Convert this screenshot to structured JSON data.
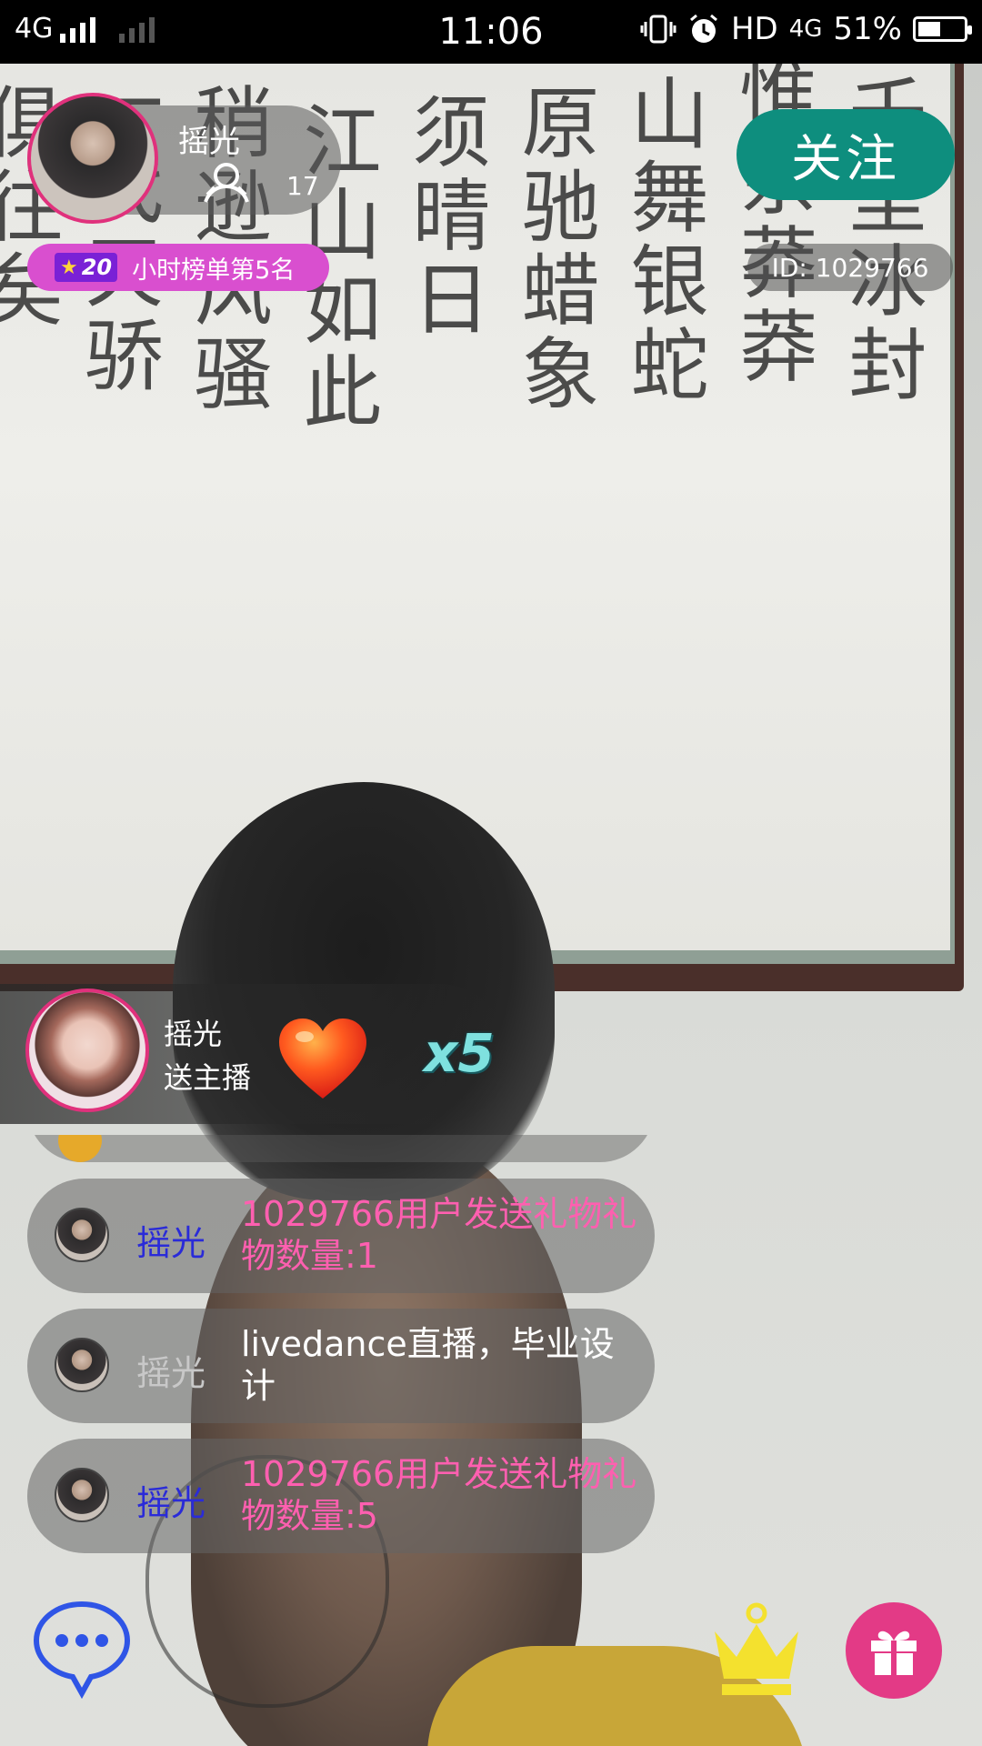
{
  "status_bar": {
    "network": "4G",
    "time": "11:06",
    "hd_label": "HD",
    "network2": "4G",
    "battery": "51%",
    "battery_level": 0.51
  },
  "host": {
    "name": "摇光",
    "fans_count": "17",
    "level": "20",
    "rank_text": "小时榜单第5名",
    "follow_label": "关注",
    "room_id": "ID: 1029766"
  },
  "gift_toast": {
    "user": "摇光",
    "action": "送主播",
    "gift_icon": "heart-icon",
    "count": "x5"
  },
  "chat": {
    "messages": [
      {
        "user": "摇光",
        "text": "1029766用户发送礼物礼物数量:1",
        "name_color": "#2a2bd8",
        "text_color": "#ff5fb0"
      },
      {
        "user": "摇光",
        "text": "livedance直播，毕业设计",
        "name_color": "#c8c8c8",
        "text_color": "#ffffff"
      },
      {
        "user": "摇光",
        "text": "1029766用户发送礼物礼物数量:5",
        "name_color": "#2a2bd8",
        "text_color": "#ff5fb0"
      }
    ]
  },
  "toolbar": {
    "chat_icon": "chat-bubble-icon",
    "crown_icon": "crown-icon",
    "gift_icon": "gift-icon"
  },
  "colors": {
    "follow_button": "#0e8e7e",
    "rank_badge": "#d94fcf",
    "avatar_border": "#e0317c",
    "gift_button": "#e33a86",
    "crown": "#f4e12e",
    "chat_icon": "#2f55e6"
  }
}
